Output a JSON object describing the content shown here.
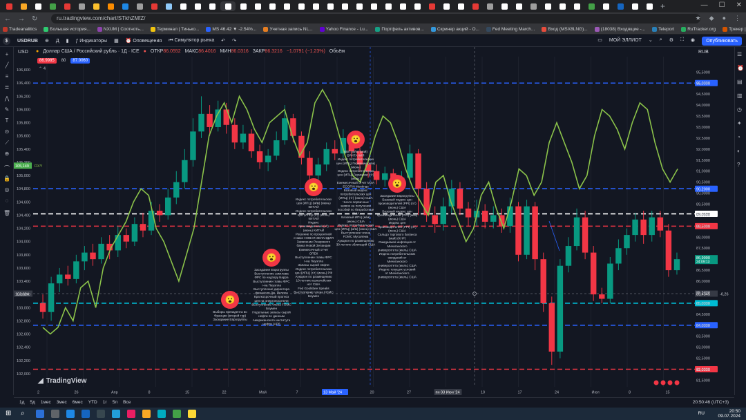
{
  "browser": {
    "url": "ru.tradingview.com/chart/STkhZMfZ/",
    "bookmarks": [
      {
        "label": "Tradeanalitics",
        "color": "#c0392b"
      },
      {
        "label": "Большая история...",
        "color": "#2ecc71"
      },
      {
        "label": "NXUM | Соотноть...",
        "color": "#8e44ad"
      },
      {
        "label": "Терминал | Тинько...",
        "color": "#f1c40f"
      },
      {
        "label": "MS 46.42 ▼ -2.54%...",
        "color": "#2962ff"
      },
      {
        "label": "Учетная запись NL...",
        "color": "#e67e22"
      },
      {
        "label": "Yahoo Finance - Lu...",
        "color": "#6001d2"
      },
      {
        "label": "Портфель активов...",
        "color": "#16a085"
      },
      {
        "label": "Скринер акций - О...",
        "color": "#3498db"
      },
      {
        "label": "Fed Meeting March...",
        "color": "#34495e"
      },
      {
        "label": "Вход (MSX8LNG)...",
        "color": "#e74c3c"
      },
      {
        "label": "(18038) Входящие -...",
        "color": "#9b59b6"
      },
      {
        "label": "Teleport",
        "color": "#2980b9"
      },
      {
        "label": "RuTracker.org",
        "color": "#27ae60"
      },
      {
        "label": "Трекер | NXM-Club",
        "color": "#d35400"
      },
      {
        "label": "TRADEANALITICS |...",
        "color": "#7f8c8d"
      }
    ],
    "other_bookmarks": "Все закладки"
  },
  "toolbar": {
    "symbol": "USDRUB",
    "indicators_label": "Индикаторы",
    "alerts_label": "Оповещения",
    "replay_label": "Симулятор рынка",
    "layout_name": "МОЙ ЭЛЛИОТ",
    "publish_label": "Опубликовать"
  },
  "legend": {
    "currency": "USD",
    "title": "Доллар США / Российский рубль · 1Д · ICE",
    "open_label": "ОТКР",
    "open_value": "86.0552",
    "high_label": "МАКС",
    "high_value": "86.4016",
    "low_label": "МИН",
    "low_value": "86.0316",
    "close_label": "ЗАКР",
    "close_value": "86.3216",
    "change": "−1.0791 (−1.23%)",
    "volume_label": "Объём",
    "sell_price": "86.9985",
    "spread": "80",
    "buy_price": "87.0060",
    "collapse_count": "4",
    "right_currency": "RUB"
  },
  "chart_data": {
    "type": "candlestick",
    "left_axis": {
      "ylim": [
        101.8,
        106.8
      ],
      "ticks": [
        "106,600",
        "106,400",
        "106,200",
        "106,000",
        "105,800",
        "105,600",
        "105,400",
        "105,200",
        "105,000",
        "104,800",
        "104,600",
        "104,400",
        "104,200",
        "104,000",
        "103,800",
        "103,600",
        "103,400",
        "103,200",
        "103,000",
        "102,800",
        "102,600",
        "102,400",
        "102,200",
        "102,000"
      ]
    },
    "right_axis": {
      "ylim": [
        81.2,
        96.2
      ],
      "ticks": [
        "95,5000",
        "95,0000",
        "94,5000",
        "94,0000",
        "93,5000",
        "93,0000",
        "92,5000",
        "92,0000",
        "91,5000",
        "91,0000",
        "90,5000",
        "90,0000",
        "89,5000",
        "89,0000",
        "88,5000",
        "88,0000",
        "87,5000",
        "87,0000",
        "86,5000",
        "86,0000",
        "85,5000",
        "85,0000",
        "84,5000",
        "84,0000",
        "83,5000",
        "83,0000",
        "82,5000",
        "82,0000",
        "81,5000"
      ]
    },
    "x_ticks": [
      "2",
      "26",
      "Апр",
      "8",
      "15",
      "22",
      "Май",
      "7",
      "13 Май '24",
      "20",
      "27",
      "пн 03 Июн '24",
      "10",
      "17",
      "24",
      "Июл",
      "8",
      "15"
    ],
    "horizontal_levels": [
      {
        "value": 95.0,
        "label": "95,0000",
        "color": "#2962ff"
      },
      {
        "value": 90.2,
        "label": "90,2000",
        "color": "#2962ff"
      },
      {
        "value": 89.06,
        "label": "89,0600",
        "color": "#ffffff"
      },
      {
        "value": 88.5,
        "label": "88,5000",
        "color": "#f23645"
      },
      {
        "value": 85.0,
        "label": "85,0000",
        "color": "#00bcd4"
      },
      {
        "value": 84.0,
        "label": "84,0000",
        "color": "#2962ff"
      },
      {
        "value": 82.0,
        "label": "82,0000",
        "color": "#f23645"
      }
    ],
    "crosshair": {
      "left_value": "103,604",
      "right_value": "85,4345",
      "delta": "-0,26"
    },
    "last_price_label": "86,9990",
    "last_price_time": "24:09:13",
    "dxy_label": "105,149",
    "dxy_tag": "DXY",
    "candles": [
      {
        "o": 85.0,
        "c": 84.6,
        "h": 85.4,
        "l": 84.3
      },
      {
        "o": 84.6,
        "c": 85.9,
        "h": 86.2,
        "l": 84.2
      },
      {
        "o": 85.9,
        "c": 86.3,
        "h": 86.6,
        "l": 85.5
      },
      {
        "o": 86.3,
        "c": 86.1,
        "h": 86.7,
        "l": 85.8
      },
      {
        "o": 86.1,
        "c": 86.9,
        "h": 87.2,
        "l": 85.9
      },
      {
        "o": 86.9,
        "c": 87.3,
        "h": 87.6,
        "l": 86.5
      },
      {
        "o": 87.3,
        "c": 87.0,
        "h": 87.7,
        "l": 86.7
      },
      {
        "o": 87.0,
        "c": 87.7,
        "h": 88.0,
        "l": 86.8
      },
      {
        "o": 87.7,
        "c": 87.4,
        "h": 88.1,
        "l": 87.0
      },
      {
        "o": 87.4,
        "c": 88.1,
        "h": 88.5,
        "l": 87.1
      },
      {
        "o": 88.1,
        "c": 87.8,
        "h": 88.4,
        "l": 87.5
      },
      {
        "o": 87.8,
        "c": 88.6,
        "h": 88.9,
        "l": 87.6
      },
      {
        "o": 88.6,
        "c": 88.3,
        "h": 89.1,
        "l": 88.0
      },
      {
        "o": 88.3,
        "c": 89.2,
        "h": 89.6,
        "l": 88.1
      },
      {
        "o": 89.2,
        "c": 89.0,
        "h": 89.5,
        "l": 88.7
      },
      {
        "o": 89.0,
        "c": 89.8,
        "h": 90.2,
        "l": 88.8
      },
      {
        "o": 89.8,
        "c": 90.5,
        "h": 91.0,
        "l": 89.5
      },
      {
        "o": 90.5,
        "c": 91.5,
        "h": 92.0,
        "l": 90.2
      },
      {
        "o": 91.5,
        "c": 92.8,
        "h": 93.4,
        "l": 91.2
      },
      {
        "o": 92.8,
        "c": 93.6,
        "h": 94.4,
        "l": 92.5
      },
      {
        "o": 93.6,
        "c": 93.0,
        "h": 94.0,
        "l": 92.6
      },
      {
        "o": 93.0,
        "c": 93.8,
        "h": 94.2,
        "l": 92.8
      },
      {
        "o": 93.8,
        "c": 93.1,
        "h": 94.1,
        "l": 92.7
      },
      {
        "o": 93.1,
        "c": 92.3,
        "h": 93.4,
        "l": 92.0
      },
      {
        "o": 92.3,
        "c": 92.7,
        "h": 93.1,
        "l": 92.0
      },
      {
        "o": 92.7,
        "c": 91.9,
        "h": 92.9,
        "l": 91.6
      },
      {
        "o": 91.9,
        "c": 91.4,
        "h": 92.2,
        "l": 91.1
      },
      {
        "o": 91.4,
        "c": 91.7,
        "h": 92.0,
        "l": 91.0
      },
      {
        "o": 91.7,
        "c": 92.4,
        "h": 92.8,
        "l": 91.5
      },
      {
        "o": 92.4,
        "c": 93.4,
        "h": 94.0,
        "l": 92.2
      },
      {
        "o": 93.4,
        "c": 92.6,
        "h": 93.6,
        "l": 92.3
      },
      {
        "o": 92.6,
        "c": 91.6,
        "h": 92.8,
        "l": 91.3
      },
      {
        "o": 91.6,
        "c": 90.8,
        "h": 91.9,
        "l": 90.5
      },
      {
        "o": 90.8,
        "c": 91.3,
        "h": 91.6,
        "l": 90.4
      },
      {
        "o": 91.3,
        "c": 92.0,
        "h": 92.3,
        "l": 91.0
      },
      {
        "o": 92.0,
        "c": 91.8,
        "h": 92.4,
        "l": 91.5
      },
      {
        "o": 91.8,
        "c": 92.5,
        "h": 92.9,
        "l": 91.6
      },
      {
        "o": 92.5,
        "c": 91.9,
        "h": 92.7,
        "l": 91.6
      },
      {
        "o": 91.9,
        "c": 91.3,
        "h": 92.1,
        "l": 91.0
      },
      {
        "o": 91.3,
        "c": 91.0,
        "h": 91.6,
        "l": 90.7
      },
      {
        "o": 91.0,
        "c": 90.6,
        "h": 91.3,
        "l": 90.4
      },
      {
        "o": 90.6,
        "c": 90.9,
        "h": 91.2,
        "l": 90.3
      },
      {
        "o": 90.9,
        "c": 90.4,
        "h": 91.1,
        "l": 90.1
      },
      {
        "o": 90.4,
        "c": 90.7,
        "h": 91.0,
        "l": 90.1
      },
      {
        "o": 90.7,
        "c": 91.8,
        "h": 92.2,
        "l": 90.5
      },
      {
        "o": 91.8,
        "c": 90.2,
        "h": 92.0,
        "l": 89.0
      },
      {
        "o": 90.2,
        "c": 89.0,
        "h": 90.5,
        "l": 88.7
      },
      {
        "o": 89.0,
        "c": 88.6,
        "h": 89.4,
        "l": 88.2
      },
      {
        "o": 88.6,
        "c": 89.4,
        "h": 89.8,
        "l": 88.3
      },
      {
        "o": 89.4,
        "c": 90.2,
        "h": 90.6,
        "l": 89.1
      },
      {
        "o": 90.2,
        "c": 89.3,
        "h": 90.5,
        "l": 89.0
      },
      {
        "o": 89.3,
        "c": 88.9,
        "h": 89.6,
        "l": 88.5
      },
      {
        "o": 88.9,
        "c": 89.2,
        "h": 89.7,
        "l": 88.5
      },
      {
        "o": 89.2,
        "c": 88.7,
        "h": 89.5,
        "l": 88.4
      },
      {
        "o": 88.7,
        "c": 89.0,
        "h": 89.4,
        "l": 88.4
      },
      {
        "o": 89.0,
        "c": 88.5,
        "h": 89.3,
        "l": 88.2
      },
      {
        "o": 88.5,
        "c": 89.4,
        "h": 89.8,
        "l": 88.2
      },
      {
        "o": 89.4,
        "c": 87.2,
        "h": 89.6,
        "l": 86.9
      },
      {
        "o": 87.2,
        "c": 89.4,
        "h": 89.7,
        "l": 87.0
      },
      {
        "o": 89.4,
        "c": 87.0,
        "h": 89.6,
        "l": 86.5
      },
      {
        "o": 87.0,
        "c": 85.0,
        "h": 87.3,
        "l": 84.6
      },
      {
        "o": 85.0,
        "c": 82.8,
        "h": 85.3,
        "l": 82.2
      },
      {
        "o": 82.8,
        "c": 86.7,
        "h": 87.0,
        "l": 82.5
      },
      {
        "o": 86.7,
        "c": 87.6,
        "h": 88.0,
        "l": 86.4
      },
      {
        "o": 87.6,
        "c": 88.9,
        "h": 89.3,
        "l": 87.4
      },
      {
        "o": 88.9,
        "c": 87.3,
        "h": 89.2,
        "l": 87.0
      },
      {
        "o": 87.3,
        "c": 85.4,
        "h": 87.6,
        "l": 85.1
      },
      {
        "o": 85.4,
        "c": 85.2,
        "h": 85.7,
        "l": 85.0
      },
      {
        "o": 85.2,
        "c": 86.8,
        "h": 87.1,
        "l": 85.0
      },
      {
        "o": 86.8,
        "c": 87.5,
        "h": 87.9,
        "l": 86.5
      },
      {
        "o": 87.5,
        "c": 88.1,
        "h": 88.4,
        "l": 87.2
      },
      {
        "o": 88.1,
        "c": 88.8,
        "h": 89.1,
        "l": 87.8
      },
      {
        "o": 88.8,
        "c": 88.1,
        "h": 89.2,
        "l": 87.7
      },
      {
        "o": 88.1,
        "c": 88.9,
        "h": 89.2,
        "l": 87.8
      },
      {
        "o": 88.9,
        "c": 88.3,
        "h": 89.2,
        "l": 88.0
      },
      {
        "o": 88.3,
        "c": 86.5,
        "h": 88.6,
        "l": 86.2
      },
      {
        "o": 86.5,
        "c": 87.0,
        "h": 87.3,
        "l": 86.3
      }
    ],
    "dxy_line": [
      102.7,
      102.6,
      102.7,
      103.0,
      102.8,
      103.3,
      103.4,
      103.0,
      103.6,
      103.9,
      104.1,
      104.3,
      104.6,
      104.8,
      104.7,
      104.2,
      104.0,
      103.7,
      103.4,
      103.8,
      104.2,
      104.9,
      105.6,
      105.9,
      106.1,
      105.8,
      106.2,
      106.0,
      105.7,
      105.5,
      105.8,
      105.9,
      106.0,
      105.6,
      105.3,
      105.5,
      106.1,
      106.3,
      106.1,
      105.7,
      105.3,
      105.0,
      104.9,
      105.2,
      105.6,
      105.9,
      105.8,
      105.5,
      105.1,
      104.8,
      104.6,
      104.4,
      104.9,
      105.0,
      104.6,
      104.3,
      104.0,
      104.2,
      104.7,
      104.9,
      104.5,
      104.2,
      104.6,
      105.1,
      105.0,
      104.7,
      104.9,
      105.5,
      105.8,
      105.5,
      105.2,
      104.8,
      105.0,
      105.6,
      106.0,
      105.9,
      105.7,
      105.4,
      105.8,
      106.1,
      106.0,
      105.5,
      105.1,
      104.9,
      105.1
    ],
    "events": [
      {
        "id": "ev1",
        "icon": "😮",
        "lines": [
          "Выборы президента во",
          "Франции (второй тур)",
          "Заседание Еврогруппы"
        ]
      },
      {
        "id": "ev2",
        "icon": "😮",
        "lines": [
          "Заседание Еврогруппы",
          "Выступление замглава",
          "ФРС по надзору Барра",
          "Выступление главы ФРС",
          "г-на Пауэлла",
          "Выступление директора",
          "финансов Дж. Йеллен",
          "Краткосрочный прогноз",
          "цен на энергоносители",
          "Выступление члена FOMC",
          "Боумен",
          "Недельные запасы сырой",
          "нефти по данным",
          "Американского института",
          "нефти (API)"
        ]
      },
      {
        "id": "ev3",
        "icon": "😮",
        "lines": [
          "Индекс потребительских",
          "цен (ИПЦ) (м/м) (июнь)",
          "КИТАЙ",
          "Индекс потребительских",
          "цен (ИПЦ) (г/г) (июнь)",
          "КИТАЙ",
          "Индекс",
          "производителей (г/г)",
          "(июнь) КИТАЙ",
          "Решение по процентной",
          "ставке НОВАЯ ЗЕЛАНДИЯ",
          "Заявление Резервного",
          "банка Новой Зеландии",
          "Ежемесячный отчет",
          "ОПЕК",
          "Выступление главы ФРС",
          "г-на Пауэлла",
          "Запасы сырой нефти",
          "Индекс потребительских",
          "цен (ИПЦ) (г/г) (июнь) РФ",
          "Аукцион по размещению",
          "10-летних казначейских",
          "нот США",
          "Fed Goolsbee Speaks",
          "Выступление члена FOMC",
          "Боумен"
        ]
      },
      {
        "id": "ev4",
        "icon": "😮",
        "lines": [
          "ВВП (м/м) (май)",
          "БРИТАНИЯ",
          "Индекс потребительских",
          "цен (ИПЦ) Германии (м/м)",
          "(июнь)",
          "Индекс потребительских",
          "цен (ИПЦ) Германии (г/г)",
          "(июнь)",
          "Ежемесячный отчет МЭА",
          "ECOFIN Meetings",
          "Базовый индекс",
          "потребительских цен",
          "(ИПЦ) (г/г) (июнь) США",
          "Число первичных",
          "заявок на получение",
          "пособий по безработице",
          "США",
          "Базовый ИПЦ (м/м)",
          "(июнь) США",
          "Индекс потребительских",
          "цен (ИПЦ) (м/м) (июнь) США",
          "Выступление члена",
          "FOMC Мусалема",
          "Аукцион по размещению",
          "30-летних облигаций США"
        ]
      },
      {
        "id": "ev5",
        "icon": "😮",
        "lines": [
          "Заседание Еврогруппы",
          "Базовый индекс цен",
          "производителей (PPI) (г/г)",
          "(июнь) США",
          "Базовый индекс цен",
          "производителей (PPI) (м/м)",
          "(июнь) США",
          "Индекс цен",
          "производителей (PPI) (г/г)",
          "(июнь) США",
          "Сальдо торгового баланса",
          "(май) (КНР)",
          "Ожидаемая инфляция от",
          "Мичиганского",
          "университета (июль) США",
          "Индекс потребительских",
          "ожиданий от",
          "Мичиганского",
          "университета (июль) США",
          "Индекс текущих условий",
          "от Мичиганского",
          "университета (июль) США"
        ]
      }
    ]
  },
  "watermark": "TradingView",
  "bottom": {
    "ranges": [
      "1д",
      "5д",
      "1мес",
      "3мес",
      "6мес",
      "YTD",
      "1г",
      "5л",
      "Все"
    ],
    "time": "20:50:46 (UTC+3)"
  },
  "taskbar": {
    "lang": "RU",
    "clock_time": "20:50",
    "clock_date": "09.07.2024"
  }
}
